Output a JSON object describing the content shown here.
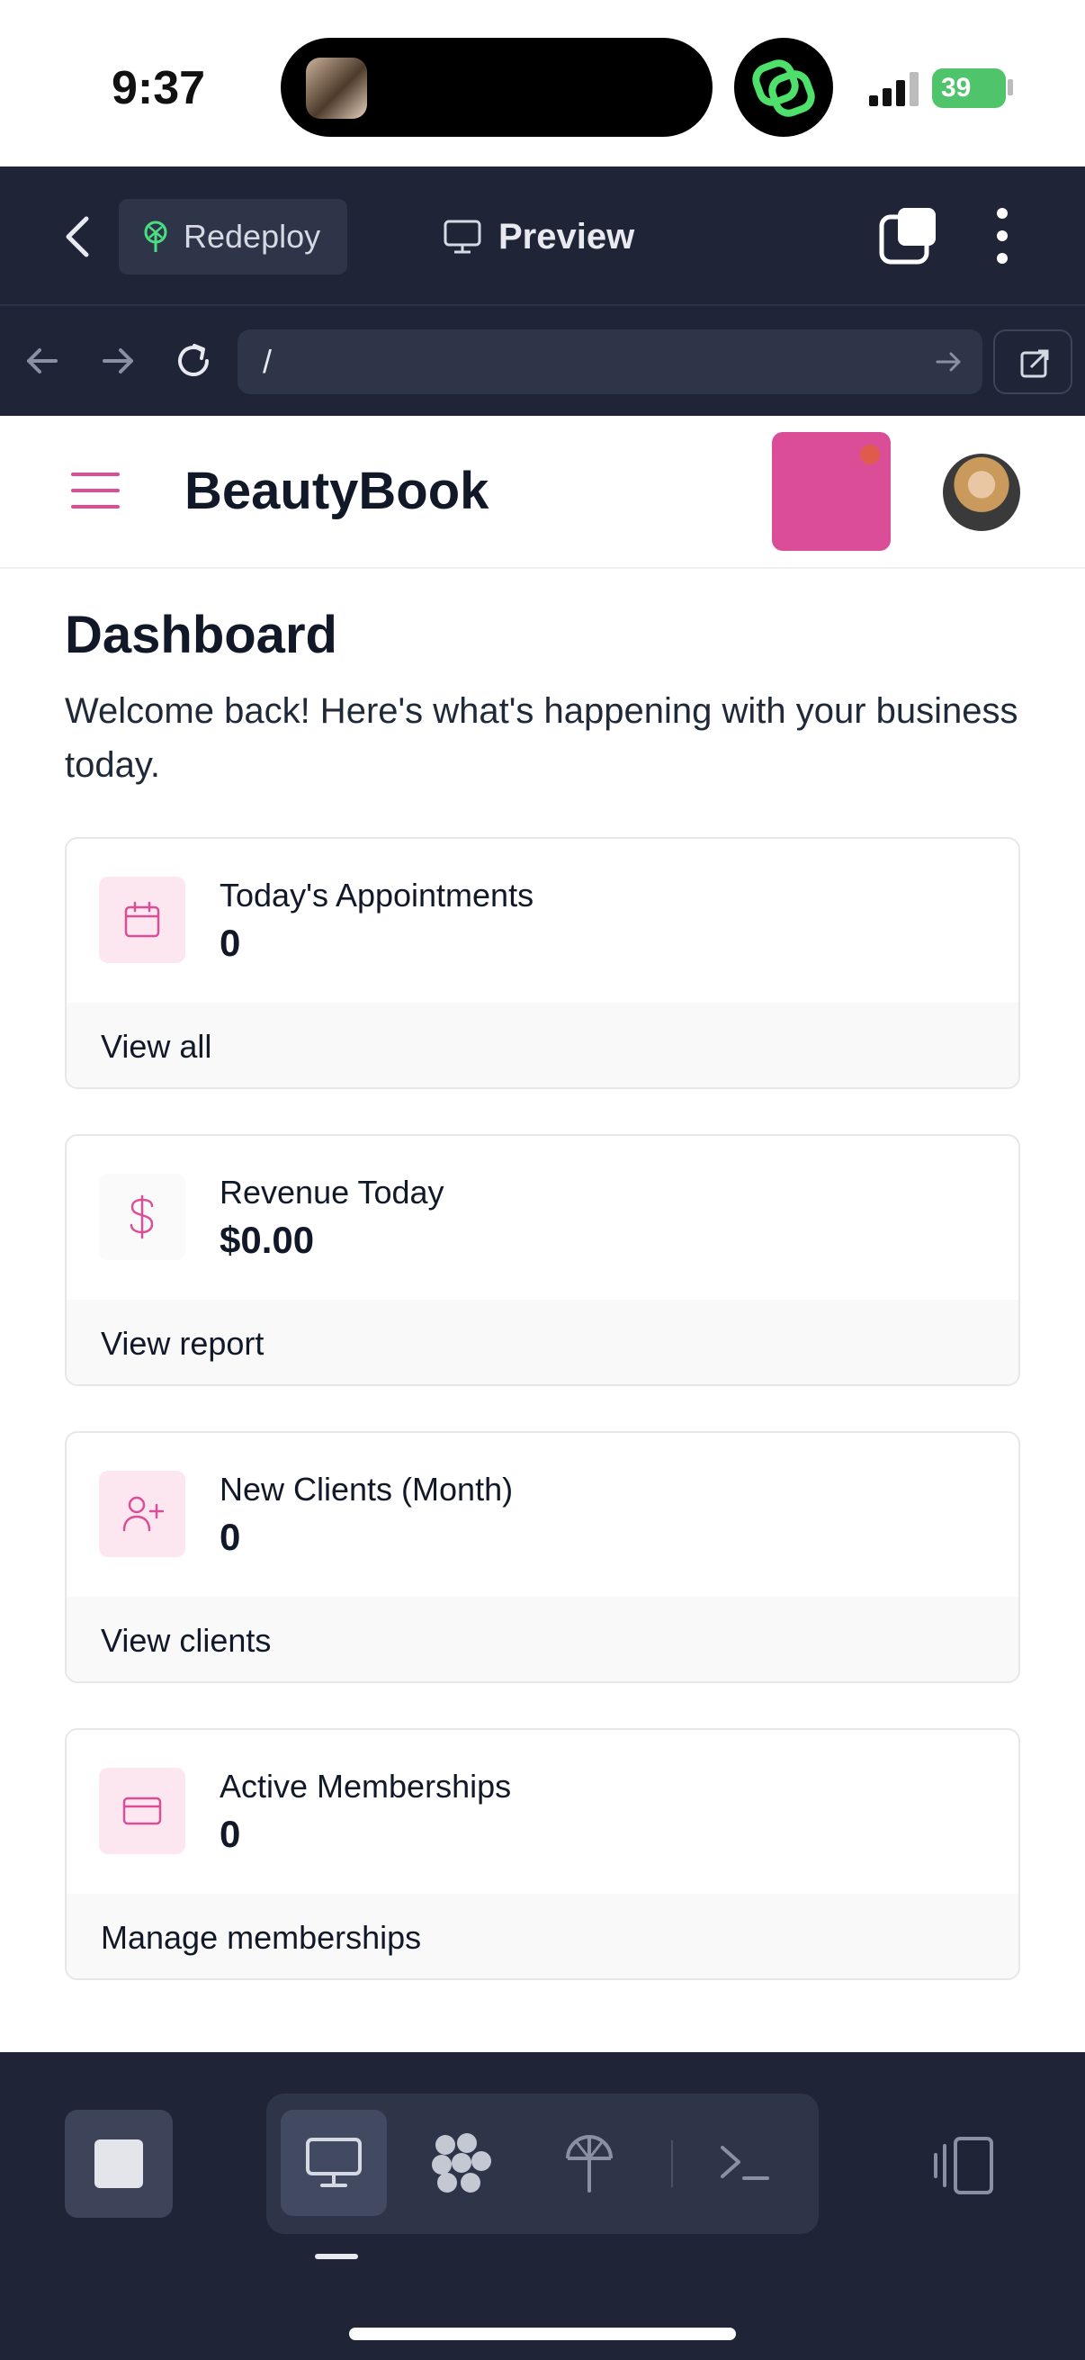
{
  "status_bar": {
    "time": "9:37",
    "battery": "39"
  },
  "browser": {
    "redeploy_label": "Redeploy",
    "preview_label": "Preview",
    "url": "/"
  },
  "app": {
    "brand": "BeautyBook"
  },
  "dashboard": {
    "title": "Dashboard",
    "subtitle": "Welcome back! Here's what's happening with your business today.",
    "cards": [
      {
        "label": "Today's Appointments",
        "value": "0",
        "link": "View all",
        "icon": "calendar-icon"
      },
      {
        "label": "Revenue Today",
        "value": "$0.00",
        "link": "View report",
        "icon": "dollar-icon"
      },
      {
        "label": "New Clients (Month)",
        "value": "0",
        "link": "View clients",
        "icon": "user-plus-icon"
      },
      {
        "label": "Active Memberships",
        "value": "0",
        "link": "Manage memberships",
        "icon": "credit-card-icon"
      }
    ]
  },
  "colors": {
    "accent": "#db4e97",
    "dark_bar": "#1f2437",
    "icon_bg": "#fce7f1"
  }
}
